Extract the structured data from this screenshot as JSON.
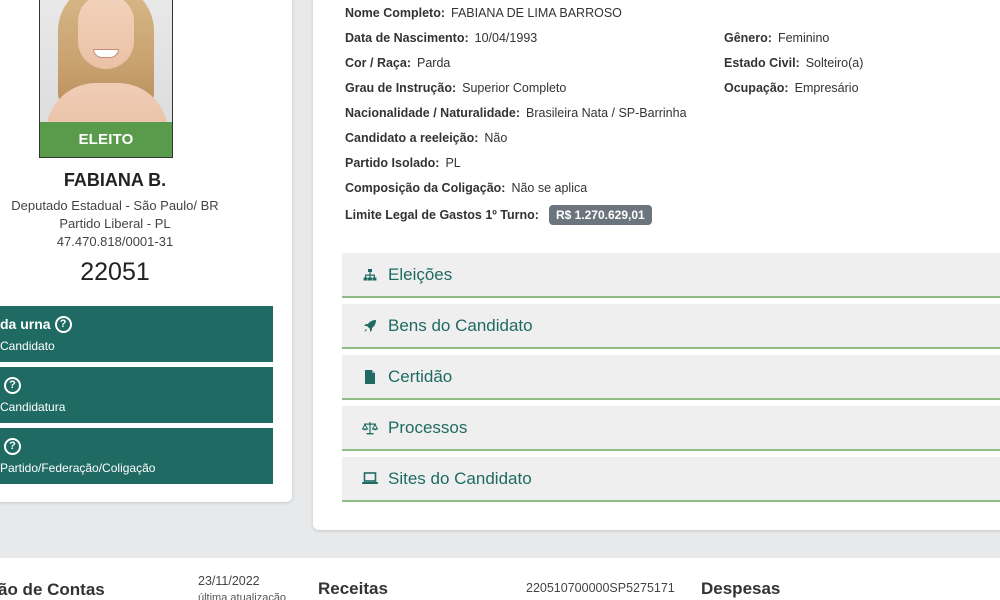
{
  "candidate": {
    "status_badge": "ELEITO",
    "short_name": "FABIANA B.",
    "office": "Deputado Estadual - São Paulo/ BR",
    "party": "Partido Liberal - PL",
    "cnpj": "47.470.818/0001-31",
    "number": "22051"
  },
  "side_buttons": [
    {
      "title": "da urna",
      "subtitle": "Candidato"
    },
    {
      "title": "",
      "subtitle": "Candidatura"
    },
    {
      "title": "",
      "subtitle": "Partido/Federação/Coligação"
    }
  ],
  "details": {
    "full_name": {
      "label": "Nome Completo:",
      "value": "FABIANA DE LIMA BARROSO"
    },
    "birth_date": {
      "label": "Data de Nascimento:",
      "value": "10/04/1993"
    },
    "gender": {
      "label": "Gênero:",
      "value": "Feminino"
    },
    "race": {
      "label": "Cor / Raça:",
      "value": "Parda"
    },
    "marital": {
      "label": "Estado Civil:",
      "value": "Solteiro(a)"
    },
    "education": {
      "label": "Grau de Instrução:",
      "value": "Superior Completo"
    },
    "occupation": {
      "label": "Ocupação:",
      "value": "Empresário"
    },
    "nationality": {
      "label": "Nacionalidade / Naturalidade:",
      "value": "Brasileira Nata / SP-Barrinha"
    },
    "reelection": {
      "label": "Candidato a reeleição:",
      "value": "Não"
    },
    "party": {
      "label": "Partido Isolado:",
      "value": "PL"
    },
    "coalition": {
      "label": "Composição da Coligação:",
      "value": "Não se aplica"
    },
    "spending_limit": {
      "label": "Limite Legal de Gastos 1º Turno:",
      "value": "R$ 1.270.629,01"
    }
  },
  "accordions": [
    {
      "label": "Eleições",
      "icon": "sitemap-icon"
    },
    {
      "label": "Bens do Candidato",
      "icon": "rocket-icon"
    },
    {
      "label": "Certidão",
      "icon": "file-icon"
    },
    {
      "label": "Processos",
      "icon": "scale-icon"
    },
    {
      "label": "Sites do Candidato",
      "icon": "laptop-icon"
    }
  ],
  "bottom": {
    "accounts_title": "ão de Contas",
    "date": "23/11/2022",
    "date_caption": "última atualização",
    "receipts_title": "Receitas",
    "receipt_id": "220510700000SP5275171",
    "expenses_title": "Despesas"
  },
  "colors": {
    "teal": "#1f6b63",
    "green_badge": "#5a9b4b",
    "accordion_border": "#8fbb84",
    "money_badge": "#6c757d"
  }
}
